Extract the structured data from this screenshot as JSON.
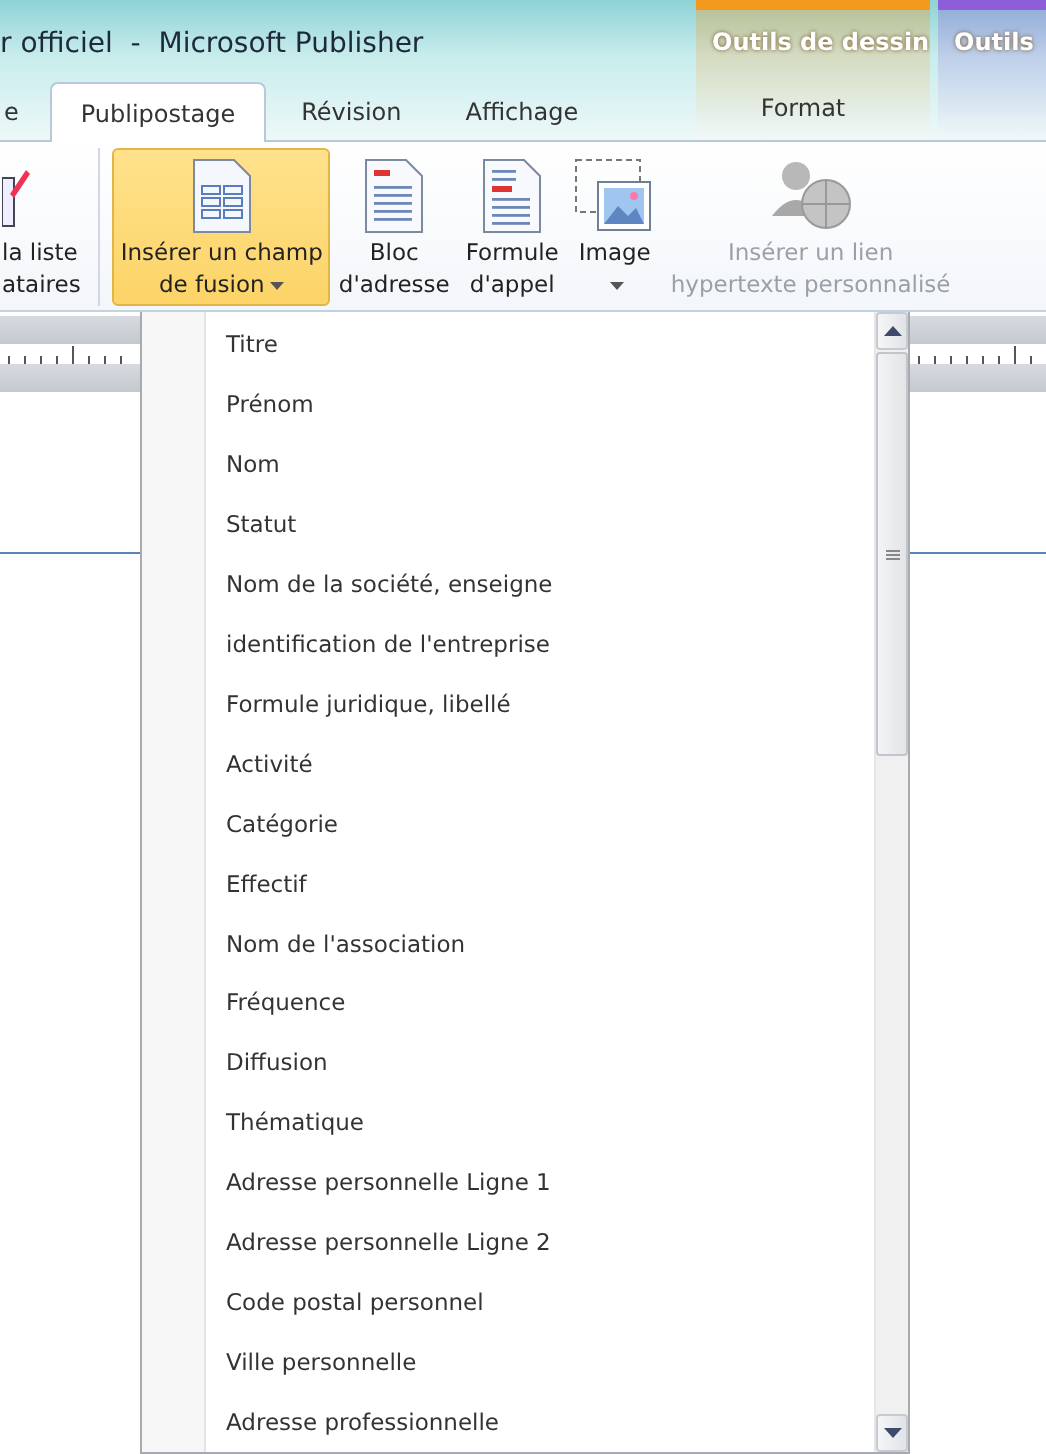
{
  "window": {
    "title": "r officiel  -  Microsoft Publisher"
  },
  "tabs": [
    {
      "label": "e",
      "selected": false
    },
    {
      "label": "Publipostage",
      "selected": true
    },
    {
      "label": "Révision",
      "selected": false
    },
    {
      "label": "Affichage",
      "selected": false
    }
  ],
  "contextual_groups": [
    {
      "label": "Outils de dessin",
      "color": "#f39a1e",
      "tabs": [
        {
          "label": "Format",
          "selected": false
        }
      ]
    },
    {
      "label": "Outils",
      "color": "#8c5fd9"
    }
  ],
  "ribbon": {
    "buttons": [
      {
        "kind": "recipients",
        "highlighted": false,
        "disabled": false,
        "lines": [
          "la liste",
          "ataires"
        ],
        "dropdown": false
      },
      {
        "kind": "merge-field",
        "highlighted": true,
        "disabled": false,
        "lines": [
          "Insérer un champ",
          "de fusion"
        ],
        "dropdown": true
      },
      {
        "kind": "address",
        "highlighted": false,
        "disabled": false,
        "lines": [
          "Bloc",
          "d'adresse"
        ],
        "dropdown": false
      },
      {
        "kind": "greeting",
        "highlighted": false,
        "disabled": false,
        "lines": [
          "Formule",
          "d'appel"
        ],
        "dropdown": false
      },
      {
        "kind": "picture",
        "highlighted": false,
        "disabled": false,
        "lines": [
          "Image"
        ],
        "dropdown": true
      },
      {
        "kind": "hyperlink",
        "highlighted": false,
        "disabled": true,
        "lines": [
          "Insérer un lien",
          "hypertexte personnalisé"
        ],
        "dropdown": false
      }
    ]
  },
  "merge_field_menu": {
    "items": [
      "Titre",
      "Prénom",
      "Nom",
      "Statut",
      "Nom de la société, enseigne",
      "identification de l'entreprise",
      "Formule juridique, libellé",
      "Activité",
      "Catégorie",
      "Effectif",
      "Nom de l'association",
      "Fréquence",
      "Diffusion",
      "Thématique",
      "Adresse personnelle Ligne 1",
      "Adresse personnelle Ligne 2",
      "Code postal personnel",
      "Ville personnelle",
      "Adresse professionnelle"
    ]
  }
}
